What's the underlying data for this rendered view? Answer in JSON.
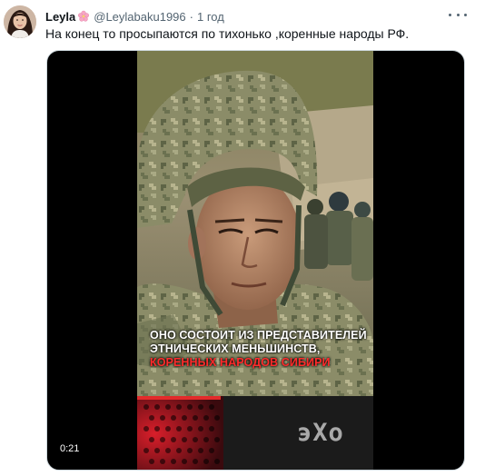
{
  "author": {
    "display_name": "Leyla",
    "emoji_icon": "cherry-blossom",
    "handle": "@Leylabaku1996",
    "separator": "·",
    "time_ago": "1 год"
  },
  "tweet": {
    "text": "На конец то просыпаются по тихонько ,коренные народы РФ."
  },
  "video": {
    "caption_line1": "ОНО СОСТОИТ ИЗ ПРЕДСТАВИТЕЛЕЙ",
    "caption_line2": "ЭТНИЧЕСКИХ МЕНЬШИНСТВ,",
    "caption_line3": "КОРЕННЫХ НАРОДОВ СИБИРИ",
    "watermark": "эХо",
    "timestamp": "0:21"
  },
  "colors": {
    "caption_accent": "#ff2b2b",
    "secondary_text": "#536471"
  }
}
